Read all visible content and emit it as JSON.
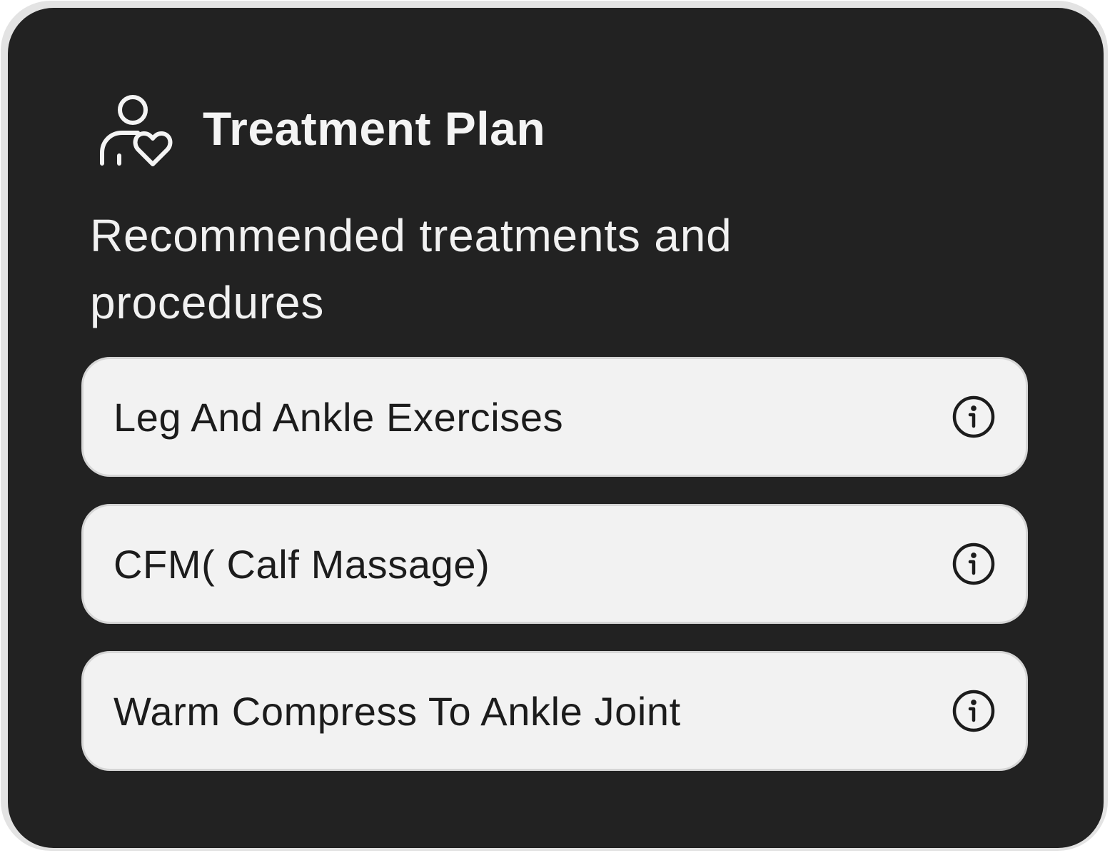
{
  "card": {
    "background": "#222222",
    "border_color": "#e3e3e3"
  },
  "header": {
    "icon": "user-heart-icon",
    "title": "Treatment Plan"
  },
  "subtitle": "Recommended treatments and procedures",
  "treatments": [
    {
      "label": "Leg And Ankle Exercises",
      "icon": "info-icon"
    },
    {
      "label": "CFM( Calf Massage)",
      "icon": "info-icon"
    },
    {
      "label": "Warm Compress To Ankle Joint",
      "icon": "info-icon"
    }
  ],
  "colors": {
    "item_background": "#f2f2f2",
    "item_border": "#d6d6d6",
    "text_light": "#f4f4f4",
    "text_dark": "#1c1c1c"
  }
}
